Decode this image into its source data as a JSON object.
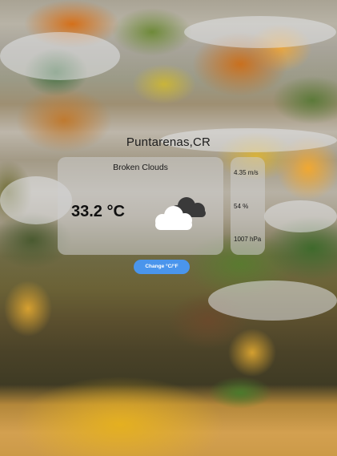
{
  "location": "Puntarenas,CR",
  "weather": {
    "condition": "Broken Clouds",
    "temperature": "33.2 °C",
    "icon": "broken-clouds-icon"
  },
  "metrics": {
    "wind": "4.35 m/s",
    "humidity": "54 %",
    "pressure": "1007 hPa"
  },
  "controls": {
    "unit_toggle_label": "Change °C/°F"
  },
  "colors": {
    "button": "#4a95ec",
    "card": "#cdcdcd"
  }
}
